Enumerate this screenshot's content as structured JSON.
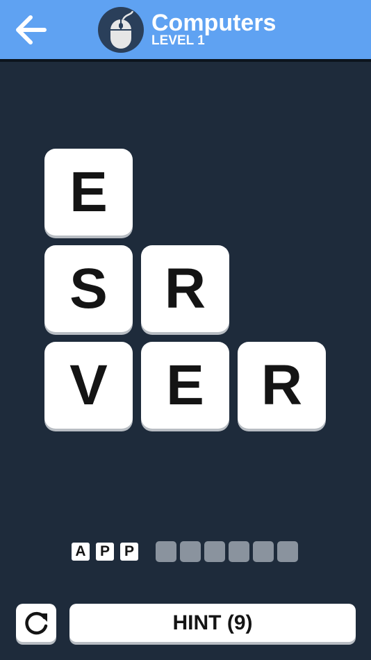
{
  "header": {
    "title": "Computers",
    "level_label": "LEVEL 1",
    "back_icon": "arrow-left-icon",
    "category_icon": "computer-mouse-icon",
    "bg_color": "#5fa2f2"
  },
  "board": {
    "tiles": [
      {
        "letter": "E"
      },
      {
        "letter": "S"
      },
      {
        "letter": "R"
      },
      {
        "letter": "V"
      },
      {
        "letter": "E"
      },
      {
        "letter": "R"
      }
    ],
    "bg_color": "#1e2b3b"
  },
  "answer": {
    "solved_word": [
      "A",
      "P",
      "P"
    ],
    "current_word_length": 6
  },
  "controls": {
    "reset_icon": "refresh-icon",
    "hint_label": "HINT (9)"
  }
}
